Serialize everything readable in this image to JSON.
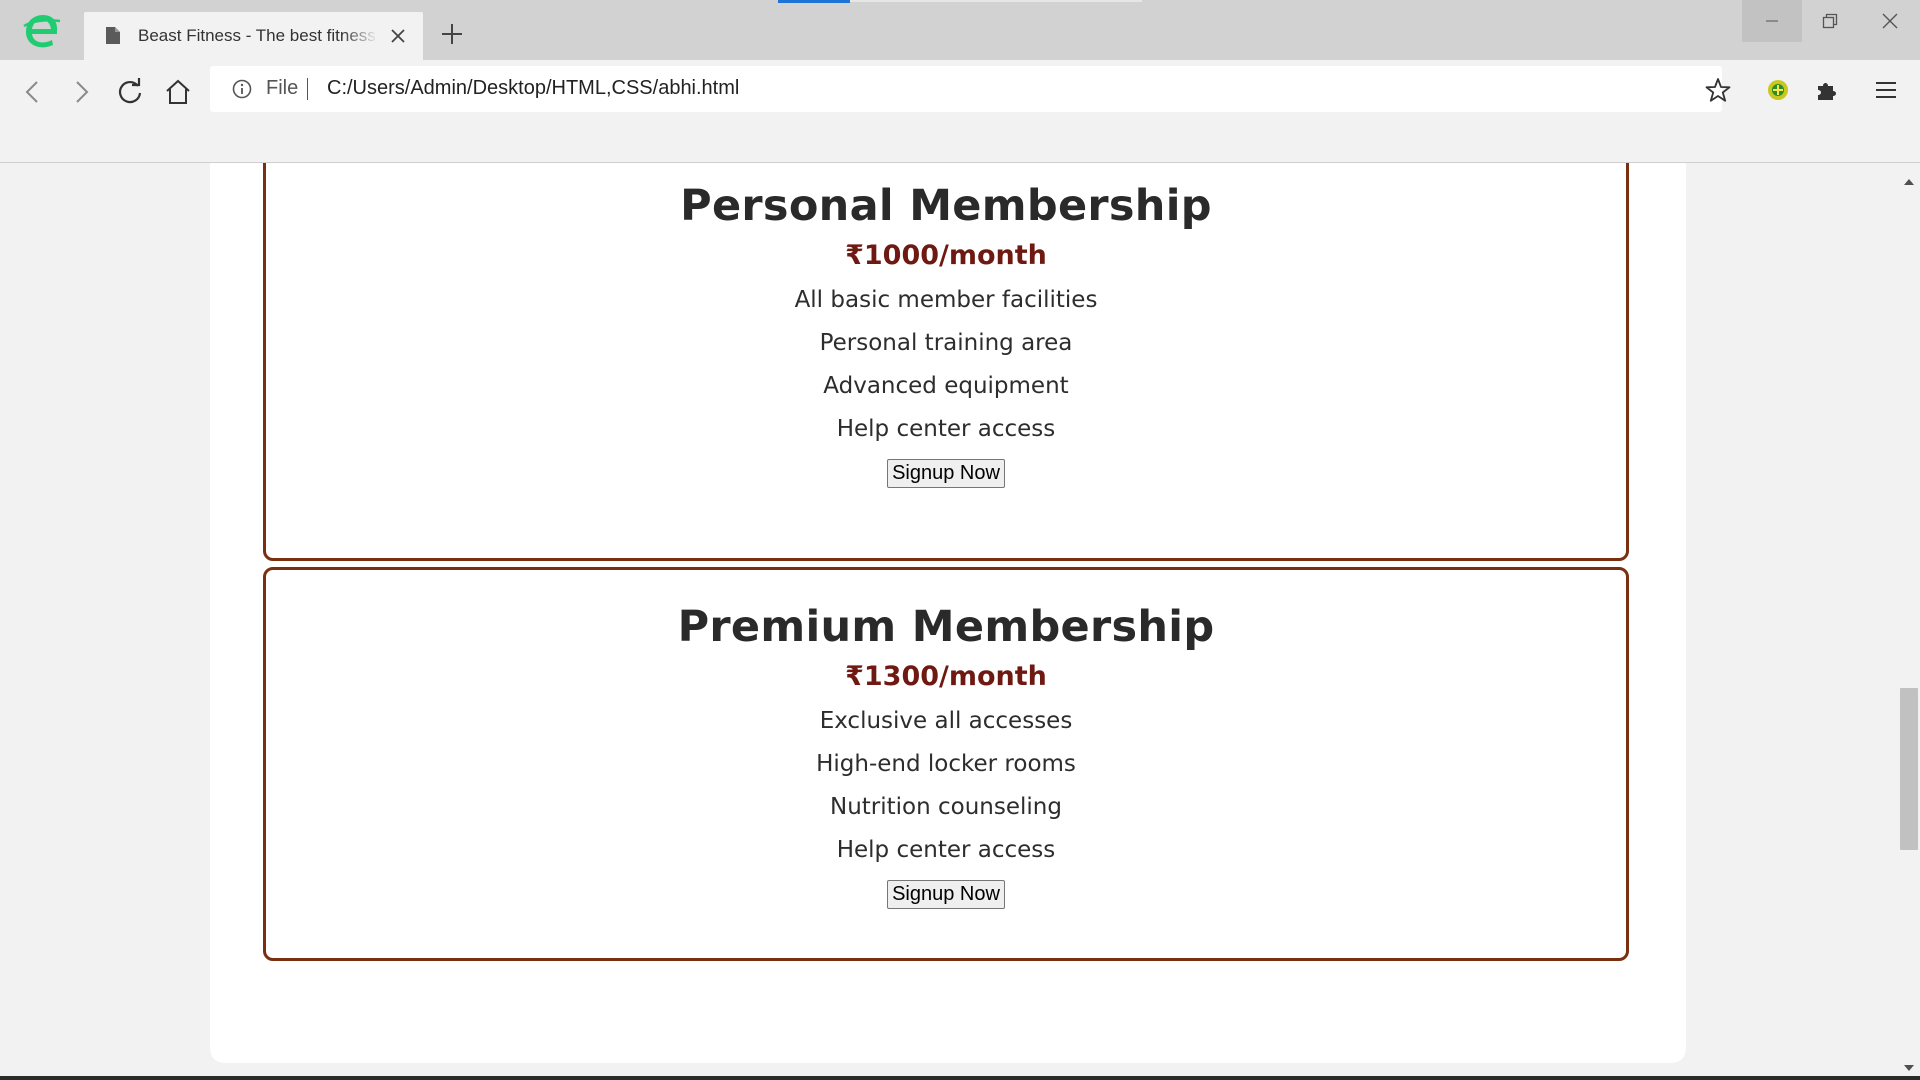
{
  "browser": {
    "tab_title": "Beast Fitness - The best fitness",
    "address": {
      "scheme": "File",
      "url": "C:/Users/Admin/Desktop/HTML,CSS/abhi.html"
    }
  },
  "memberships": [
    {
      "title": "Personal Membership",
      "price": "₹1000/month",
      "features": [
        "All basic member facilities",
        "Personal training area",
        "Advanced equipment",
        "Help center access"
      ],
      "button": "Signup Now"
    },
    {
      "title": "Premium Membership",
      "price": "₹1300/month",
      "features": [
        "Exclusive all accesses",
        "High-end locker rooms",
        "Nutrition counseling",
        "Help center access"
      ],
      "button": "Signup Now"
    }
  ],
  "colors": {
    "card_border": "#7a2f10",
    "price": "#6e1a12",
    "logo": "#1fcc72"
  },
  "icons": [
    "app-logo-icon",
    "document-icon",
    "close-icon",
    "plus-icon",
    "back-icon",
    "forward-icon",
    "reload-icon",
    "home-icon",
    "info-icon",
    "star-icon",
    "extension-icon",
    "puzzle-icon",
    "menu-icon"
  ]
}
